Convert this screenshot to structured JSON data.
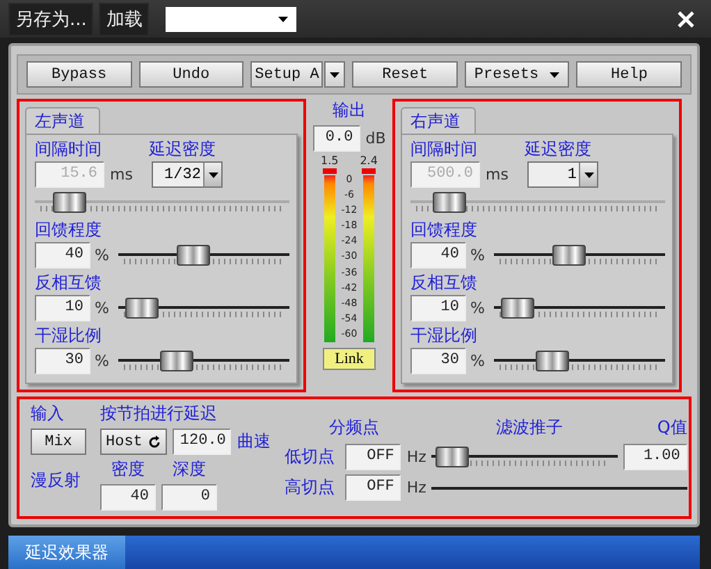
{
  "top_bar": {
    "buttons": [
      "另存为...",
      "加载"
    ]
  },
  "toolbar": [
    {
      "label": "Bypass",
      "kind": "button"
    },
    {
      "label": "Undo",
      "kind": "button"
    },
    {
      "label": "Setup A",
      "kind": "split"
    },
    {
      "label": "Reset",
      "kind": "button"
    },
    {
      "label": "Presets",
      "kind": "dropdown"
    },
    {
      "label": "Help",
      "kind": "button"
    }
  ],
  "channels": [
    {
      "tab": "左声道",
      "interval_label": "间隔时间",
      "interval_value": "15.6",
      "interval_unit": "ms",
      "interval_disabled": true,
      "interval_slider": {
        "level": 0.08
      },
      "density_label": "延迟密度",
      "density_value": "1/32",
      "sliders": [
        {
          "label": "回馈程度",
          "value": "40",
          "unit": "%",
          "level": 0.42
        },
        {
          "label": "反相互馈",
          "value": "10",
          "unit": "%",
          "level": 0.05
        },
        {
          "label": "干湿比例",
          "value": "30",
          "unit": "%",
          "level": 0.3
        }
      ]
    },
    {
      "tab": "右声道",
      "interval_label": "间隔时间",
      "interval_value": "500.0",
      "interval_unit": "ms",
      "interval_disabled": true,
      "interval_slider": {
        "level": 0.1
      },
      "density_label": "延迟密度",
      "density_value": "1",
      "sliders": [
        {
          "label": "回馈程度",
          "value": "40",
          "unit": "%",
          "level": 0.42
        },
        {
          "label": "反相互馈",
          "value": "10",
          "unit": "%",
          "level": 0.05
        },
        {
          "label": "干湿比例",
          "value": "30",
          "unit": "%",
          "level": 0.3
        }
      ]
    }
  ],
  "output": {
    "label": "输出",
    "value": "0.0",
    "unit": "dB",
    "meters": [
      {
        "peak": "1.5",
        "clip": true,
        "level": 1
      },
      {
        "peak": "2.4",
        "clip": true,
        "level": 1
      }
    ],
    "scale": [
      "0",
      "-6",
      "-12",
      "-18",
      "-24",
      "-30",
      "-36",
      "-42",
      "-48",
      "-54",
      "-60"
    ],
    "link_button": "Link"
  },
  "bottom": {
    "input_label": "输入",
    "mix_button": "Mix",
    "tempo_label": "按节拍进行延迟",
    "host_button": "Host",
    "tempo_value": "120.0",
    "tempo_unit": "曲速",
    "diffusion_label": "漫反射",
    "density_label": "密度",
    "density_value": "40",
    "depth_label": "深度",
    "depth_value": "0",
    "crossover_label": "分频点",
    "filter_label": "滤波推子",
    "q_label": "Q值",
    "q_value": "1.00",
    "low_cut": {
      "label": "低切点",
      "value": "OFF",
      "unit": "Hz",
      "level": 0.02
    },
    "high_cut": {
      "label": "高切点",
      "value": "OFF",
      "unit": "Hz"
    }
  },
  "footer_tabs": [
    {
      "label": "延迟效果器",
      "selected": true
    }
  ]
}
